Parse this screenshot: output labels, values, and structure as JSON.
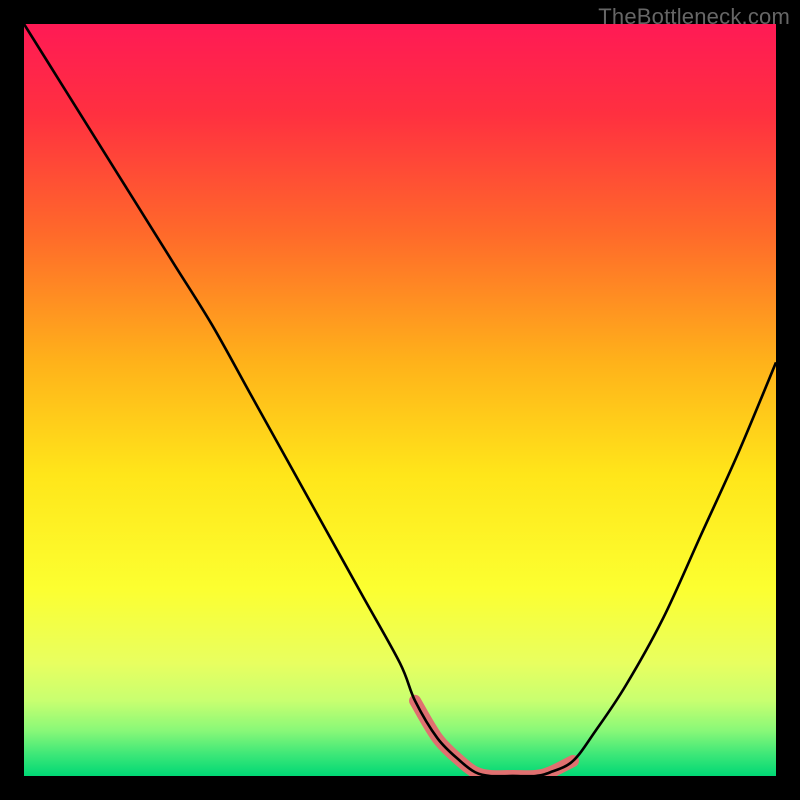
{
  "watermark": "TheBottleneck.com",
  "chart_data": {
    "type": "line",
    "title": "",
    "xlabel": "",
    "ylabel": "",
    "xlim": [
      0,
      100
    ],
    "ylim": [
      0,
      100
    ],
    "x": [
      0,
      5,
      10,
      15,
      20,
      25,
      30,
      35,
      40,
      45,
      50,
      52,
      55,
      58,
      60,
      62,
      65,
      68,
      70,
      73,
      76,
      80,
      85,
      90,
      95,
      100
    ],
    "values": [
      100,
      92,
      84,
      76,
      68,
      60,
      51,
      42,
      33,
      24,
      15,
      10,
      5,
      2,
      0.5,
      0,
      0,
      0,
      0.5,
      2,
      6,
      12,
      21,
      32,
      43,
      55
    ],
    "highlight_x_range": [
      52,
      73
    ],
    "gradient_stops": [
      {
        "pos": 0.0,
        "color": "#ff1a55"
      },
      {
        "pos": 0.12,
        "color": "#ff3040"
      },
      {
        "pos": 0.28,
        "color": "#ff6a2a"
      },
      {
        "pos": 0.45,
        "color": "#ffb21a"
      },
      {
        "pos": 0.6,
        "color": "#ffe61a"
      },
      {
        "pos": 0.75,
        "color": "#fcff30"
      },
      {
        "pos": 0.85,
        "color": "#e8ff60"
      },
      {
        "pos": 0.9,
        "color": "#c8ff70"
      },
      {
        "pos": 0.94,
        "color": "#88f878"
      },
      {
        "pos": 0.97,
        "color": "#40e878"
      },
      {
        "pos": 1.0,
        "color": "#00d875"
      }
    ],
    "curve_color": "#000000",
    "highlight_color": "#e07070",
    "highlight_width": 12
  }
}
